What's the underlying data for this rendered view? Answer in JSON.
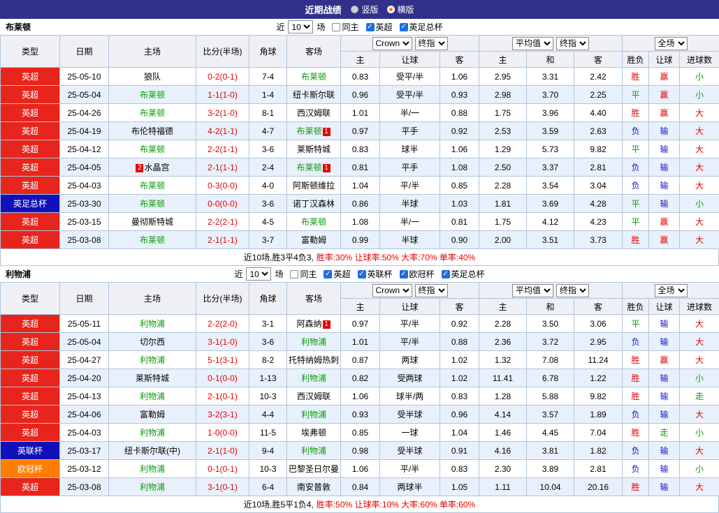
{
  "topbar": {
    "title": "近期战绩",
    "radios": [
      {
        "label": "竖版",
        "selected": false
      },
      {
        "label": "横版",
        "selected": true
      }
    ]
  },
  "table_header": {
    "fixed_cols": [
      "类型",
      "日期",
      "主场",
      "比分(半场)",
      "角球",
      "客场"
    ],
    "group1_selects": [
      "Crown",
      "终指"
    ],
    "group2_selects": [
      "平均值",
      "终指"
    ],
    "group3_selects": [
      "全场"
    ],
    "sub_cols": [
      "主",
      "让球",
      "客",
      "主",
      "和",
      "客",
      "胜负",
      "让球",
      "进球数"
    ]
  },
  "league_colors": {
    "英超": "#e8251c",
    "英足总杯": "#1111bb",
    "英联杯": "#1111bb",
    "欧冠杯": "#ff7e00"
  },
  "result_colors": {
    "red": "#e60000",
    "green": "#0a9b0a",
    "blue": "#1515cc"
  },
  "sections": [
    {
      "team": "布莱顿",
      "filter": {
        "near_label": "近",
        "count": "10",
        "games_label": "场",
        "checkboxes": [
          {
            "label": "同主",
            "checked": false
          },
          {
            "label": "英超",
            "checked": true
          },
          {
            "label": "英足总杯",
            "checked": true
          }
        ]
      },
      "rows": [
        {
          "league": "英超",
          "date": "25-05-10",
          "home": "狼队",
          "home_focus": false,
          "home_badge_before": "",
          "home_badge_after": "",
          "score": "0-2(0-1)",
          "corner": "7-4",
          "away": "布莱顿",
          "away_focus": true,
          "away_badge_after": "",
          "odds": [
            "0.83",
            "受平/半",
            "1.06"
          ],
          "avg": [
            "2.95",
            "3.31",
            "2.42"
          ],
          "results": [
            {
              "text": "胜",
              "color": "red"
            },
            {
              "text": "赢",
              "color": "red"
            },
            {
              "text": "小",
              "color": "green"
            }
          ]
        },
        {
          "league": "英超",
          "date": "25-05-04",
          "home": "布莱顿",
          "home_focus": true,
          "home_badge_before": "",
          "home_badge_after": "",
          "score": "1-1(1-0)",
          "corner": "1-4",
          "away": "纽卡斯尔联",
          "away_focus": false,
          "away_badge_after": "",
          "odds": [
            "0.96",
            "受平/半",
            "0.93"
          ],
          "avg": [
            "2.98",
            "3.70",
            "2.25"
          ],
          "results": [
            {
              "text": "平",
              "color": "green"
            },
            {
              "text": "赢",
              "color": "red"
            },
            {
              "text": "小",
              "color": "green"
            }
          ]
        },
        {
          "league": "英超",
          "date": "25-04-26",
          "home": "布莱顿",
          "home_focus": true,
          "home_badge_before": "",
          "home_badge_after": "",
          "score": "3-2(1-0)",
          "corner": "8-1",
          "away": "西汉姆联",
          "away_focus": false,
          "away_badge_after": "",
          "odds": [
            "1.01",
            "半/一",
            "0.88"
          ],
          "avg": [
            "1.75",
            "3.96",
            "4.40"
          ],
          "results": [
            {
              "text": "胜",
              "color": "red"
            },
            {
              "text": "赢",
              "color": "red"
            },
            {
              "text": "大",
              "color": "red"
            }
          ]
        },
        {
          "league": "英超",
          "date": "25-04-19",
          "home": "布伦特福德",
          "home_focus": false,
          "home_badge_before": "",
          "home_badge_after": "",
          "score": "4-2(1-1)",
          "corner": "4-7",
          "away": "布莱顿",
          "away_focus": true,
          "away_badge_after": "1",
          "odds": [
            "0.97",
            "平手",
            "0.92"
          ],
          "avg": [
            "2.53",
            "3.59",
            "2.63"
          ],
          "results": [
            {
              "text": "负",
              "color": "blue"
            },
            {
              "text": "输",
              "color": "blue"
            },
            {
              "text": "大",
              "color": "red"
            }
          ]
        },
        {
          "league": "英超",
          "date": "25-04-12",
          "home": "布莱顿",
          "home_focus": true,
          "home_badge_before": "",
          "home_badge_after": "",
          "score": "2-2(1-1)",
          "corner": "3-6",
          "away": "莱斯特城",
          "away_focus": false,
          "away_badge_after": "",
          "odds": [
            "0.83",
            "球半",
            "1.06"
          ],
          "avg": [
            "1.29",
            "5.73",
            "9.82"
          ],
          "results": [
            {
              "text": "平",
              "color": "green"
            },
            {
              "text": "输",
              "color": "blue"
            },
            {
              "text": "大",
              "color": "red"
            }
          ]
        },
        {
          "league": "英超",
          "date": "25-04-05",
          "home": "水晶宫",
          "home_focus": false,
          "home_badge_before": "2",
          "home_badge_after": "",
          "score": "2-1(1-1)",
          "corner": "2-4",
          "away": "布莱顿",
          "away_focus": true,
          "away_badge_after": "1",
          "odds": [
            "0.81",
            "平手",
            "1.08"
          ],
          "avg": [
            "2.50",
            "3.37",
            "2.81"
          ],
          "results": [
            {
              "text": "负",
              "color": "blue"
            },
            {
              "text": "输",
              "color": "blue"
            },
            {
              "text": "大",
              "color": "red"
            }
          ]
        },
        {
          "league": "英超",
          "date": "25-04-03",
          "home": "布莱顿",
          "home_focus": true,
          "home_badge_before": "",
          "home_badge_after": "",
          "score": "0-3(0-0)",
          "corner": "4-0",
          "away": "阿斯顿维拉",
          "away_focus": false,
          "away_badge_after": "",
          "odds": [
            "1.04",
            "平/半",
            "0.85"
          ],
          "avg": [
            "2.28",
            "3.54",
            "3.04"
          ],
          "results": [
            {
              "text": "负",
              "color": "blue"
            },
            {
              "text": "输",
              "color": "blue"
            },
            {
              "text": "大",
              "color": "red"
            }
          ]
        },
        {
          "league": "英足总杯",
          "date": "25-03-30",
          "home": "布莱顿",
          "home_focus": true,
          "home_badge_before": "",
          "home_badge_after": "",
          "score": "0-0(0-0)",
          "corner": "3-6",
          "away": "诺丁汉森林",
          "away_focus": false,
          "away_badge_after": "",
          "odds": [
            "0.86",
            "半球",
            "1.03"
          ],
          "avg": [
            "1.81",
            "3.69",
            "4.28"
          ],
          "results": [
            {
              "text": "平",
              "color": "green"
            },
            {
              "text": "输",
              "color": "blue"
            },
            {
              "text": "小",
              "color": "green"
            }
          ]
        },
        {
          "league": "英超",
          "date": "25-03-15",
          "home": "曼彻斯特城",
          "home_focus": false,
          "home_badge_before": "",
          "home_badge_after": "",
          "score": "2-2(2-1)",
          "corner": "4-5",
          "away": "布莱顿",
          "away_focus": true,
          "away_badge_after": "",
          "odds": [
            "1.08",
            "半/一",
            "0.81"
          ],
          "avg": [
            "1.75",
            "4.12",
            "4.23"
          ],
          "results": [
            {
              "text": "平",
              "color": "green"
            },
            {
              "text": "赢",
              "color": "red"
            },
            {
              "text": "大",
              "color": "red"
            }
          ]
        },
        {
          "league": "英超",
          "date": "25-03-08",
          "home": "布莱顿",
          "home_focus": true,
          "home_badge_before": "",
          "home_badge_after": "",
          "score": "2-1(1-1)",
          "corner": "3-7",
          "away": "富勒姆",
          "away_focus": false,
          "away_badge_after": "",
          "odds": [
            "0.99",
            "半球",
            "0.90"
          ],
          "avg": [
            "2.00",
            "3.51",
            "3.73"
          ],
          "results": [
            {
              "text": "胜",
              "color": "red"
            },
            {
              "text": "赢",
              "color": "red"
            },
            {
              "text": "大",
              "color": "red"
            }
          ]
        }
      ],
      "summary": {
        "record": "近10场,胜3平4负3,",
        "stats": "胜率:30% 让球率:50% 大率:70% 单率:40%"
      }
    },
    {
      "team": "利物浦",
      "filter": {
        "near_label": "近",
        "count": "10",
        "games_label": "场",
        "checkboxes": [
          {
            "label": "同主",
            "checked": false
          },
          {
            "label": "英超",
            "checked": true
          },
          {
            "label": "英联杯",
            "checked": true
          },
          {
            "label": "欧冠杯",
            "checked": true
          },
          {
            "label": "英足总杯",
            "checked": true
          }
        ]
      },
      "rows": [
        {
          "league": "英超",
          "date": "25-05-11",
          "home": "利物浦",
          "home_focus": true,
          "home_badge_before": "",
          "home_badge_after": "",
          "score": "2-2(2-0)",
          "corner": "3-1",
          "away": "阿森纳",
          "away_focus": false,
          "away_badge_after": "1",
          "odds": [
            "0.97",
            "平/半",
            "0.92"
          ],
          "avg": [
            "2.28",
            "3.50",
            "3.06"
          ],
          "results": [
            {
              "text": "平",
              "color": "green"
            },
            {
              "text": "输",
              "color": "blue"
            },
            {
              "text": "大",
              "color": "red"
            }
          ]
        },
        {
          "league": "英超",
          "date": "25-05-04",
          "home": "切尔西",
          "home_focus": false,
          "home_badge_before": "",
          "home_badge_after": "",
          "score": "3-1(1-0)",
          "corner": "3-6",
          "away": "利物浦",
          "away_focus": true,
          "away_badge_after": "",
          "odds": [
            "1.01",
            "平/半",
            "0.88"
          ],
          "avg": [
            "2.36",
            "3.72",
            "2.95"
          ],
          "results": [
            {
              "text": "负",
              "color": "blue"
            },
            {
              "text": "输",
              "color": "blue"
            },
            {
              "text": "大",
              "color": "red"
            }
          ]
        },
        {
          "league": "英超",
          "date": "25-04-27",
          "home": "利物浦",
          "home_focus": true,
          "home_badge_before": "",
          "home_badge_after": "",
          "score": "5-1(3-1)",
          "corner": "8-2",
          "away": "托特纳姆热刺",
          "away_focus": false,
          "away_badge_after": "",
          "odds": [
            "0.87",
            "两球",
            "1.02"
          ],
          "avg": [
            "1.32",
            "7.08",
            "11.24"
          ],
          "results": [
            {
              "text": "胜",
              "color": "red"
            },
            {
              "text": "赢",
              "color": "red"
            },
            {
              "text": "大",
              "color": "red"
            }
          ]
        },
        {
          "league": "英超",
          "date": "25-04-20",
          "home": "莱斯特城",
          "home_focus": false,
          "home_badge_before": "",
          "home_badge_after": "",
          "score": "0-1(0-0)",
          "corner": "1-13",
          "away": "利物浦",
          "away_focus": true,
          "away_badge_after": "",
          "odds": [
            "0.82",
            "受两球",
            "1.02"
          ],
          "avg": [
            "11.41",
            "6.78",
            "1.22"
          ],
          "results": [
            {
              "text": "胜",
              "color": "red"
            },
            {
              "text": "输",
              "color": "blue"
            },
            {
              "text": "小",
              "color": "green"
            }
          ]
        },
        {
          "league": "英超",
          "date": "25-04-13",
          "home": "利物浦",
          "home_focus": true,
          "home_badge_before": "",
          "home_badge_after": "",
          "score": "2-1(0-1)",
          "corner": "10-3",
          "away": "西汉姆联",
          "away_focus": false,
          "away_badge_after": "",
          "odds": [
            "1.06",
            "球半/两",
            "0.83"
          ],
          "avg": [
            "1.28",
            "5.88",
            "9.82"
          ],
          "results": [
            {
              "text": "胜",
              "color": "red"
            },
            {
              "text": "输",
              "color": "blue"
            },
            {
              "text": "走",
              "color": "green"
            }
          ]
        },
        {
          "league": "英超",
          "date": "25-04-06",
          "home": "富勒姆",
          "home_focus": false,
          "home_badge_before": "",
          "home_badge_after": "",
          "score": "3-2(3-1)",
          "corner": "4-4",
          "away": "利物浦",
          "away_focus": true,
          "away_badge_after": "",
          "odds": [
            "0.93",
            "受半球",
            "0.96"
          ],
          "avg": [
            "4.14",
            "3.57",
            "1.89"
          ],
          "results": [
            {
              "text": "负",
              "color": "blue"
            },
            {
              "text": "输",
              "color": "blue"
            },
            {
              "text": "大",
              "color": "red"
            }
          ]
        },
        {
          "league": "英超",
          "date": "25-04-03",
          "home": "利物浦",
          "home_focus": true,
          "home_badge_before": "",
          "home_badge_after": "",
          "score": "1-0(0-0)",
          "corner": "11-5",
          "away": "埃弗顿",
          "away_focus": false,
          "away_badge_after": "",
          "odds": [
            "0.85",
            "一球",
            "1.04"
          ],
          "avg": [
            "1.46",
            "4.45",
            "7.04"
          ],
          "results": [
            {
              "text": "胜",
              "color": "red"
            },
            {
              "text": "走",
              "color": "green"
            },
            {
              "text": "小",
              "color": "green"
            }
          ]
        },
        {
          "league": "英联杯",
          "date": "25-03-17",
          "home": "纽卡斯尔联(中)",
          "home_focus": false,
          "home_badge_before": "",
          "home_badge_after": "",
          "score": "2-1(1-0)",
          "corner": "9-4",
          "away": "利物浦",
          "away_focus": true,
          "away_badge_after": "",
          "odds": [
            "0.98",
            "受半球",
            "0.91"
          ],
          "avg": [
            "4.16",
            "3.81",
            "1.82"
          ],
          "results": [
            {
              "text": "负",
              "color": "blue"
            },
            {
              "text": "输",
              "color": "blue"
            },
            {
              "text": "大",
              "color": "red"
            }
          ]
        },
        {
          "league": "欧冠杯",
          "date": "25-03-12",
          "home": "利物浦",
          "home_focus": true,
          "home_badge_before": "",
          "home_badge_after": "",
          "score": "0-1(0-1)",
          "corner": "10-3",
          "away": "巴黎圣日尔曼",
          "away_focus": false,
          "away_badge_after": "",
          "odds": [
            "1.06",
            "平/半",
            "0.83"
          ],
          "avg": [
            "2.30",
            "3.89",
            "2.81"
          ],
          "results": [
            {
              "text": "负",
              "color": "blue"
            },
            {
              "text": "输",
              "color": "blue"
            },
            {
              "text": "小",
              "color": "green"
            }
          ]
        },
        {
          "league": "英超",
          "date": "25-03-08",
          "home": "利物浦",
          "home_focus": true,
          "home_badge_before": "",
          "home_badge_after": "",
          "score": "3-1(0-1)",
          "corner": "6-4",
          "away": "南安普敦",
          "away_focus": false,
          "away_badge_after": "",
          "odds": [
            "0.84",
            "两球半",
            "1.05"
          ],
          "avg": [
            "1.11",
            "10.04",
            "20.16"
          ],
          "results": [
            {
              "text": "胜",
              "color": "red"
            },
            {
              "text": "输",
              "color": "blue"
            },
            {
              "text": "大",
              "color": "red"
            }
          ]
        }
      ],
      "summary": {
        "record": "近10场,胜5平1负4,",
        "stats": "胜率:50% 让球率:10% 大率:60% 单率:60%"
      }
    }
  ]
}
